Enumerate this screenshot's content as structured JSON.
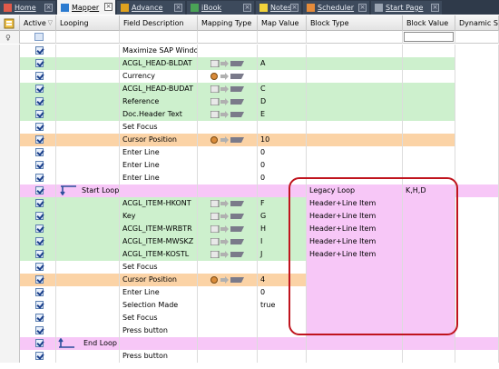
{
  "tabs": [
    {
      "label": "Home",
      "icon": "home-icon",
      "active": false
    },
    {
      "label": "Mapper",
      "icon": "mapper-icon",
      "active": true
    },
    {
      "label": "Advance",
      "icon": "advance-icon",
      "active": false
    },
    {
      "label": "iBook",
      "icon": "book-icon",
      "active": false
    },
    {
      "label": "Notes",
      "icon": "notes-icon",
      "active": false
    },
    {
      "label": "Scheduler",
      "icon": "scheduler-icon",
      "active": false
    },
    {
      "label": "Start Page",
      "icon": "start-page-icon",
      "active": false
    }
  ],
  "close_glyph": "×",
  "columns": {
    "active": "Active",
    "looping": "Looping",
    "field": "Field Description",
    "mapping": "Mapping Type",
    "map_value": "Map Value",
    "block_type": "Block Type",
    "block_value": "Block Value",
    "dynamic": "Dynamic Skip"
  },
  "colors": {
    "green": "#cdf0cd",
    "orange": "#fbd3a6",
    "pink": "#f7c7f7",
    "highlight_outline": "#c0141e",
    "tabbar": "#2f3a4a"
  },
  "rows": [
    {
      "loop": "",
      "field": "Maximize SAP Window",
      "mapping": "",
      "map_value": "",
      "block_type": "",
      "block_value": "",
      "color": "white"
    },
    {
      "loop": "",
      "field": "ACGL_HEAD-BLDAT",
      "mapping": "field",
      "map_value": "A",
      "block_type": "",
      "block_value": "",
      "color": "green"
    },
    {
      "loop": "",
      "field": "Currency",
      "mapping": "fixed",
      "map_value": "",
      "block_type": "",
      "block_value": "",
      "color": "white"
    },
    {
      "loop": "",
      "field": "ACGL_HEAD-BUDAT",
      "mapping": "field",
      "map_value": "C",
      "block_type": "",
      "block_value": "",
      "color": "green"
    },
    {
      "loop": "",
      "field": "Reference",
      "mapping": "field",
      "map_value": "D",
      "block_type": "",
      "block_value": "",
      "color": "green"
    },
    {
      "loop": "",
      "field": "Doc.Header Text",
      "mapping": "field",
      "map_value": "E",
      "block_type": "",
      "block_value": "",
      "color": "green"
    },
    {
      "loop": "",
      "field": "Set Focus",
      "mapping": "",
      "map_value": "",
      "block_type": "",
      "block_value": "",
      "color": "white"
    },
    {
      "loop": "",
      "field": "Cursor Position",
      "mapping": "fixed",
      "map_value": "10",
      "block_type": "",
      "block_value": "",
      "color": "orange"
    },
    {
      "loop": "",
      "field": "Enter Line",
      "mapping": "",
      "map_value": "0",
      "block_type": "",
      "block_value": "",
      "color": "white"
    },
    {
      "loop": "",
      "field": "Enter Line",
      "mapping": "",
      "map_value": "0",
      "block_type": "",
      "block_value": "",
      "color": "white"
    },
    {
      "loop": "",
      "field": "Enter Line",
      "mapping": "",
      "map_value": "0",
      "block_type": "",
      "block_value": "",
      "color": "white"
    },
    {
      "loop": "Start Loop",
      "loop_kind": "start",
      "field": "",
      "mapping": "",
      "map_value": "",
      "block_type": "Legacy Loop",
      "block_value": "K,H,D",
      "color": "pink"
    },
    {
      "loop": "",
      "field": "ACGL_ITEM-HKONT",
      "mapping": "field",
      "map_value": "F",
      "block_type": "Header+Line Item",
      "block_value": "",
      "color": "green"
    },
    {
      "loop": "",
      "field": "Key",
      "mapping": "field",
      "map_value": "G",
      "block_type": "Header+Line Item",
      "block_value": "",
      "color": "green"
    },
    {
      "loop": "",
      "field": "ACGL_ITEM-WRBTR",
      "mapping": "field",
      "map_value": "H",
      "block_type": "Header+Line Item",
      "block_value": "",
      "color": "green"
    },
    {
      "loop": "",
      "field": "ACGL_ITEM-MWSKZ",
      "mapping": "field",
      "map_value": "I",
      "block_type": "Header+Line Item",
      "block_value": "",
      "color": "green"
    },
    {
      "loop": "",
      "field": "ACGL_ITEM-KOSTL",
      "mapping": "field",
      "map_value": "J",
      "block_type": "Header+Line Item",
      "block_value": "",
      "color": "green"
    },
    {
      "loop": "",
      "field": "Set Focus",
      "mapping": "",
      "map_value": "",
      "block_type": "",
      "block_value": "",
      "color": "white"
    },
    {
      "loop": "",
      "field": "Cursor Position",
      "mapping": "fixed",
      "map_value": "4",
      "block_type": "",
      "block_value": "",
      "color": "orange"
    },
    {
      "loop": "",
      "field": "Enter Line",
      "mapping": "",
      "map_value": "0",
      "block_type": "",
      "block_value": "",
      "color": "white"
    },
    {
      "loop": "",
      "field": "Selection Made",
      "mapping": "",
      "map_value": "true",
      "block_type": "",
      "block_value": "",
      "color": "white"
    },
    {
      "loop": "",
      "field": "Set Focus",
      "mapping": "",
      "map_value": "",
      "block_type": "",
      "block_value": "",
      "color": "white"
    },
    {
      "loop": "",
      "field": "Press button",
      "mapping": "",
      "map_value": "",
      "block_type": "",
      "block_value": "",
      "color": "white"
    },
    {
      "loop": "End Loop",
      "loop_kind": "end",
      "field": "",
      "mapping": "",
      "map_value": "",
      "block_type": "",
      "block_value": "",
      "color": "pink"
    },
    {
      "loop": "",
      "field": "Press button",
      "mapping": "",
      "map_value": "",
      "block_type": "",
      "block_value": "",
      "color": "white"
    }
  ]
}
